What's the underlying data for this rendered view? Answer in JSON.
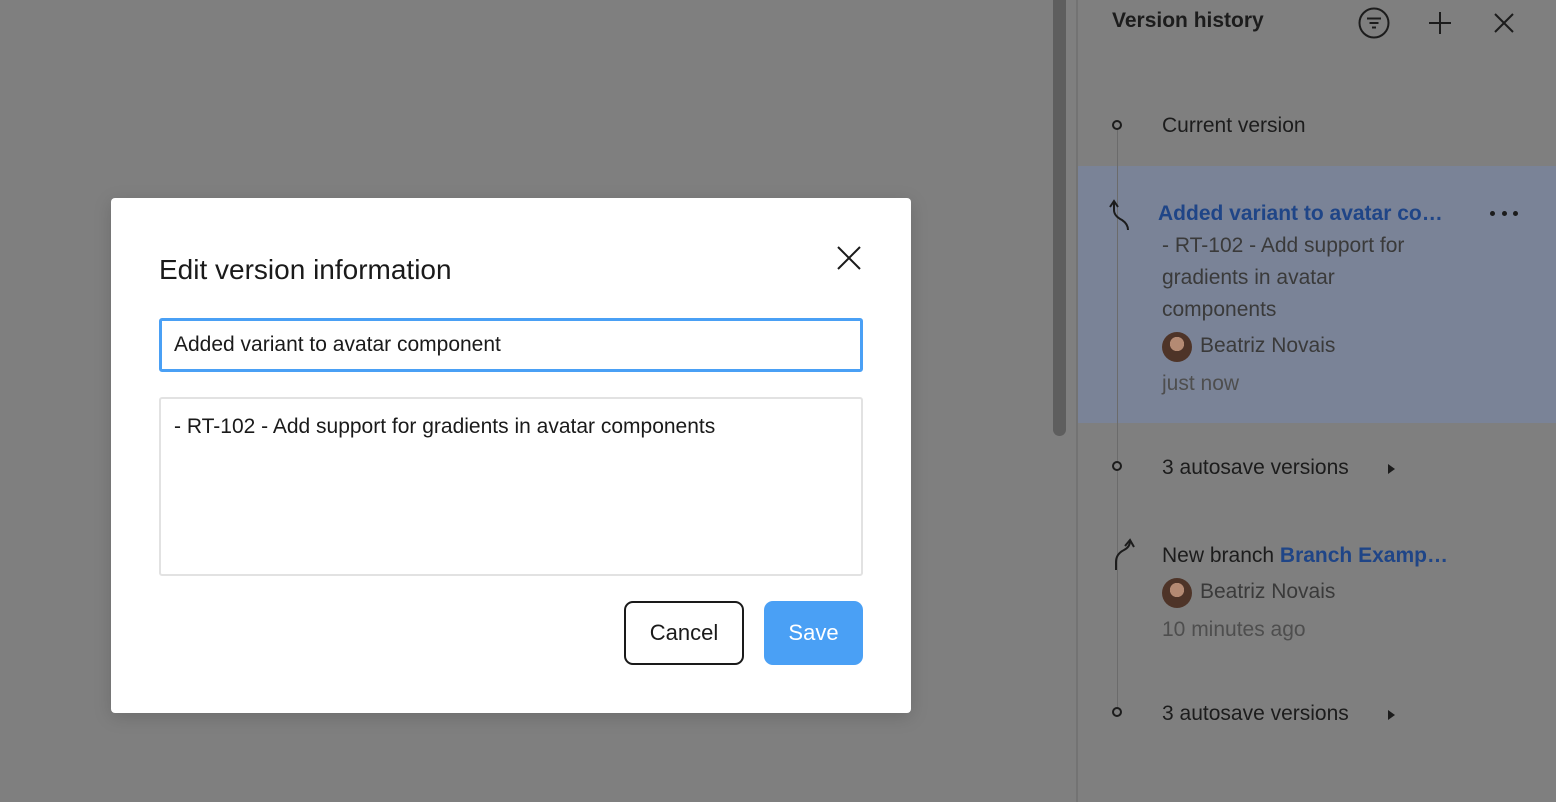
{
  "modal": {
    "title": "Edit version information",
    "title_value": "Added variant to avatar component",
    "description_value": "- RT-102 - Add support for gradients in avatar components",
    "cancel_label": "Cancel",
    "save_label": "Save"
  },
  "panel": {
    "title": "Version history",
    "icons": [
      "filter-icon",
      "plus-icon",
      "close-icon"
    ],
    "current_version_label": "Current version",
    "versions": [
      {
        "title": "Added variant to avatar co…",
        "description_lines": [
          "- RT-102 - Add support for",
          "gradients in avatar",
          "components"
        ],
        "author": "Beatriz Novais",
        "time": "just now",
        "highlighted": true
      },
      {
        "autosave_label": "3 autosave versions"
      },
      {
        "prefix": "New branch",
        "branch_name": "Branch Examp…",
        "author": "Beatriz Novais",
        "time": "10 minutes ago"
      },
      {
        "autosave_label": "3 autosave versions"
      }
    ],
    "more_icon": "more-horizontal-icon"
  },
  "colors": {
    "accent": "#4aa0f5",
    "link": "#1f4587",
    "overlay": "#7f7f7f"
  }
}
